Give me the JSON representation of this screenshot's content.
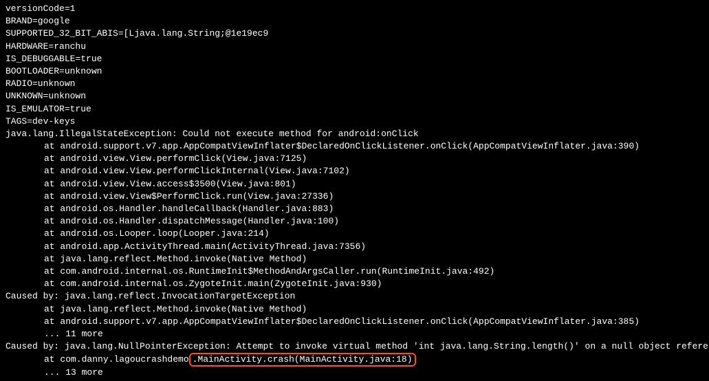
{
  "props": {
    "versionCode": "versionCode=1",
    "brand": "BRAND=google",
    "supported32": "SUPPORTED_32_BIT_ABIS=[Ljava.lang.String;@1e19ec9",
    "hardware": "HARDWARE=ranchu",
    "isDebuggable": "IS_DEBUGGABLE=true",
    "bootloader": "BOOTLOADER=unknown",
    "radio": "RADIO=unknown",
    "unknown": "UNKNOWN=unknown",
    "isEmulator": "IS_EMULATOR=true",
    "tags": "TAGS=dev-keys"
  },
  "exception1": {
    "header": "java.lang.IllegalStateException: Could not execute method for android:onClick",
    "stack": [
      "at android.support.v7.app.AppCompatViewInflater$DeclaredOnClickListener.onClick(AppCompatViewInflater.java:390)",
      "at android.view.View.performClick(View.java:7125)",
      "at android.view.View.performClickInternal(View.java:7102)",
      "at android.view.View.access$3500(View.java:801)",
      "at android.view.View$PerformClick.run(View.java:27336)",
      "at android.os.Handler.handleCallback(Handler.java:883)",
      "at android.os.Handler.dispatchMessage(Handler.java:100)",
      "at android.os.Looper.loop(Looper.java:214)",
      "at android.app.ActivityThread.main(ActivityThread.java:7356)",
      "at java.lang.reflect.Method.invoke(Native Method)",
      "at com.android.internal.os.RuntimeInit$MethodAndArgsCaller.run(RuntimeInit.java:492)",
      "at com.android.internal.os.ZygoteInit.main(ZygoteInit.java:930)"
    ]
  },
  "caused1": {
    "header": "Caused by: java.lang.reflect.InvocationTargetException",
    "stack": [
      "at java.lang.reflect.Method.invoke(Native Method)",
      "at android.support.v7.app.AppCompatViewInflater$DeclaredOnClickListener.onClick(AppCompatViewInflater.java:385)"
    ],
    "more": "... 11 more"
  },
  "caused2": {
    "header": "Caused by: java.lang.NullPointerException: Attempt to invoke virtual method 'int java.lang.String.length()' on a null object reference",
    "stackPrefix": "at com.danny.lagoucrashdemo",
    "stackHighlighted": ".MainActivity.crash(MainActivity.java:18)",
    "more": "... 13 more"
  }
}
